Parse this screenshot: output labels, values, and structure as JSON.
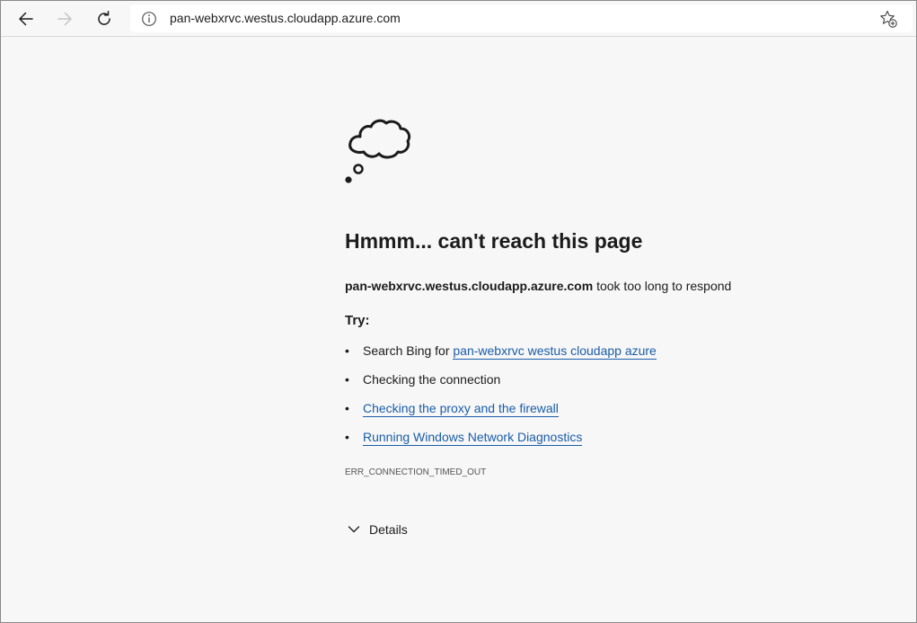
{
  "toolbar": {
    "back_icon": "arrow-left-icon",
    "forward_icon": "arrow-right-icon",
    "refresh_icon": "refresh-icon",
    "address": {
      "info_icon": "info-icon",
      "url": "pan-webxrvc.westus.cloudapp.azure.com",
      "favorite_icon": "star-add-icon"
    }
  },
  "error": {
    "illustration_icon": "thought-cloud-icon",
    "heading": "Hmmm... can't reach this page",
    "host": "pan-webxrvc.westus.cloudapp.azure.com",
    "message": " took too long to respond",
    "try_label": "Try:",
    "suggestions": [
      {
        "prefix": "Search Bing for ",
        "link": "pan-webxrvc westus cloudapp azure"
      },
      {
        "text": "Checking the connection"
      },
      {
        "link": "Checking the proxy and the firewall"
      },
      {
        "link": "Running Windows Network Diagnostics"
      }
    ],
    "bullet": "•",
    "code": "ERR_CONNECTION_TIMED_OUT",
    "details_label": "Details",
    "details_icon": "chevron-down-icon"
  },
  "colors": {
    "background": "#f7f7f7",
    "link": "#1a5da8",
    "text": "#1b1b1b"
  }
}
